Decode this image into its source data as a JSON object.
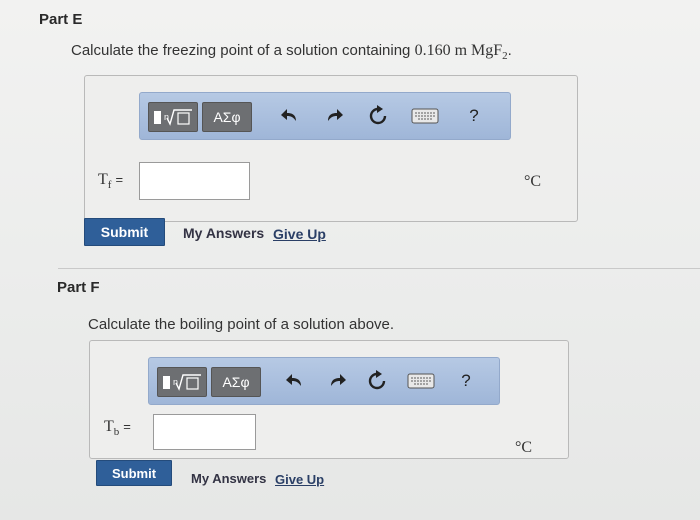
{
  "part_e": {
    "title": "Part E",
    "question_prefix": "Calculate the freezing point of a solution containing ",
    "question_math": "0.160 m MgF",
    "question_sub": "2",
    "question_suffix": ".",
    "toolbar": {
      "greek_label": "ΑΣφ",
      "help_label": "?"
    },
    "variable": "T",
    "variable_sub": "f",
    "equals": "=",
    "input_value": "",
    "unit": "°C",
    "submit_label": "Submit",
    "my_answers_label": "My Answers",
    "give_up_label": "Give Up"
  },
  "part_f": {
    "title": "Part F",
    "question": "Calculate the boiling point of a solution above.",
    "toolbar": {
      "greek_label": "ΑΣφ",
      "help_label": "?"
    },
    "variable": "T",
    "variable_sub": "b",
    "equals": "=",
    "input_value": "",
    "unit": "°C",
    "submit_label": "Submit",
    "my_answers_label": "My Answers",
    "give_up_label": "Give Up"
  },
  "colors": {
    "toolbar": "#a9bfe0",
    "submit": "#2f5f99",
    "dark_button": "#6d6f72"
  },
  "icons": [
    "templates-icon",
    "undo-icon",
    "redo-icon",
    "reset-icon",
    "keyboard-icon",
    "help-icon"
  ]
}
